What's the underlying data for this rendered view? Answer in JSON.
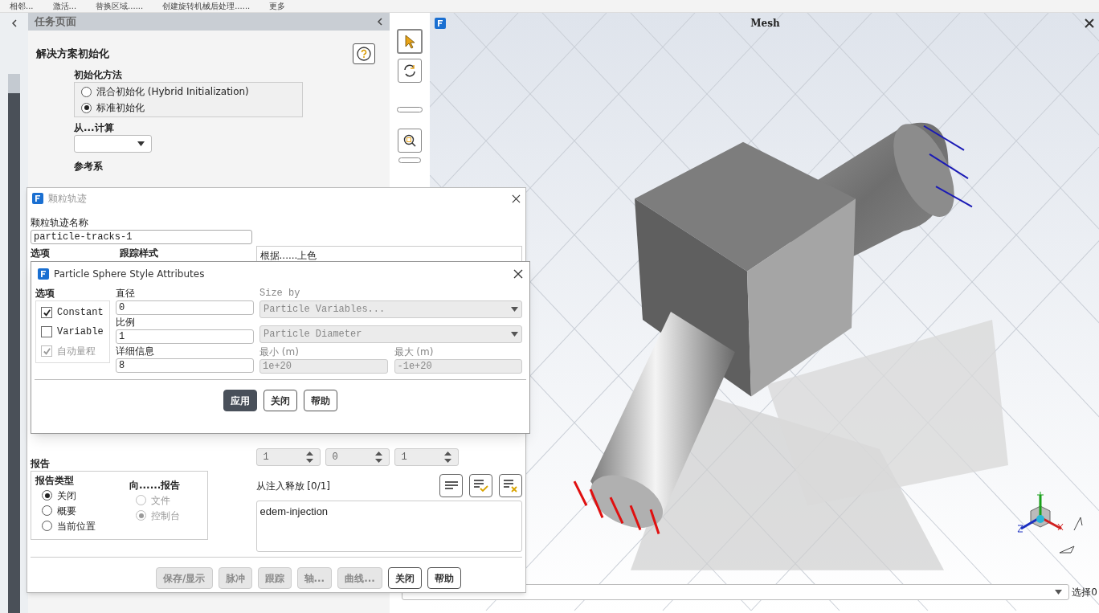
{
  "toolbar": {
    "items": [
      {
        "label": "相邻..."
      },
      {
        "label": "激活..."
      },
      {
        "label": "替换区域......"
      },
      {
        "label": "创建旋转机械后处理......"
      },
      {
        "label": "更多"
      }
    ]
  },
  "task_page": {
    "title": "任务页面",
    "heading": "解决方案初始化",
    "method": {
      "label": "初始化方法",
      "options": [
        {
          "label": "混合初始化 (Hybrid Initialization)",
          "selected": false
        },
        {
          "label": "标准初始化",
          "selected": true
        }
      ]
    },
    "compute_from": {
      "label": "从...计算"
    },
    "reference_frame": {
      "label": "参考系"
    }
  },
  "viewport": {
    "title": "Mesh",
    "selection_label": "选择0"
  },
  "particle_tracks": {
    "title": "颗粒轨迹",
    "name_label": "颗粒轨迹名称",
    "name_value": "particle-tracks-1",
    "options_label": "选项",
    "style_label": "跟踪样式",
    "color_by_label": "根据......上色",
    "spinners": [
      {
        "value": "1"
      },
      {
        "value": "0"
      },
      {
        "value": "1"
      }
    ],
    "report": {
      "label": "报告",
      "type_label": "报告类型",
      "types": [
        {
          "label": "关闭",
          "selected": true
        },
        {
          "label": "概要",
          "selected": false
        },
        {
          "label": "当前位置",
          "selected": false
        }
      ],
      "to_label": "向......报告",
      "to": [
        {
          "label": "文件",
          "selected": false,
          "disabled": true
        },
        {
          "label": "控制台",
          "selected": true,
          "disabled": true
        }
      ]
    },
    "release_label": "从注入释放 [0/1]",
    "injections": [
      "edem-injection"
    ],
    "buttons": [
      {
        "label": "保存/显示",
        "disabled": true
      },
      {
        "label": "脉冲",
        "disabled": true
      },
      {
        "label": "跟踪",
        "disabled": true
      },
      {
        "label": "轴...",
        "disabled": true
      },
      {
        "label": "曲线...",
        "disabled": true
      },
      {
        "label": "关闭",
        "disabled": false
      },
      {
        "label": "帮助",
        "disabled": false
      }
    ]
  },
  "sphere_attributes": {
    "title": "Particle Sphere Style Attributes",
    "options_label": "选项",
    "options": [
      {
        "label": "Constant",
        "checked": true,
        "disabled": false
      },
      {
        "label": "Variable",
        "checked": false,
        "disabled": false
      },
      {
        "label": "自动量程",
        "checked": true,
        "disabled": true
      }
    ],
    "fields": [
      {
        "label": "直径",
        "value": "0"
      },
      {
        "label": "比例",
        "value": "1"
      },
      {
        "label": "详细信息",
        "value": "8"
      }
    ],
    "size_by": {
      "label": "Size by",
      "disabled": true,
      "selects": [
        "Particle Variables...",
        "Particle Diameter"
      ],
      "min": {
        "label": "最小 (m)",
        "value": "1e+20"
      },
      "max": {
        "label": "最大 (m)",
        "value": "-1e+20"
      }
    },
    "buttons": [
      {
        "label": "应用",
        "primary": true
      },
      {
        "label": "关闭",
        "primary": false
      },
      {
        "label": "帮助",
        "primary": false
      }
    ]
  }
}
